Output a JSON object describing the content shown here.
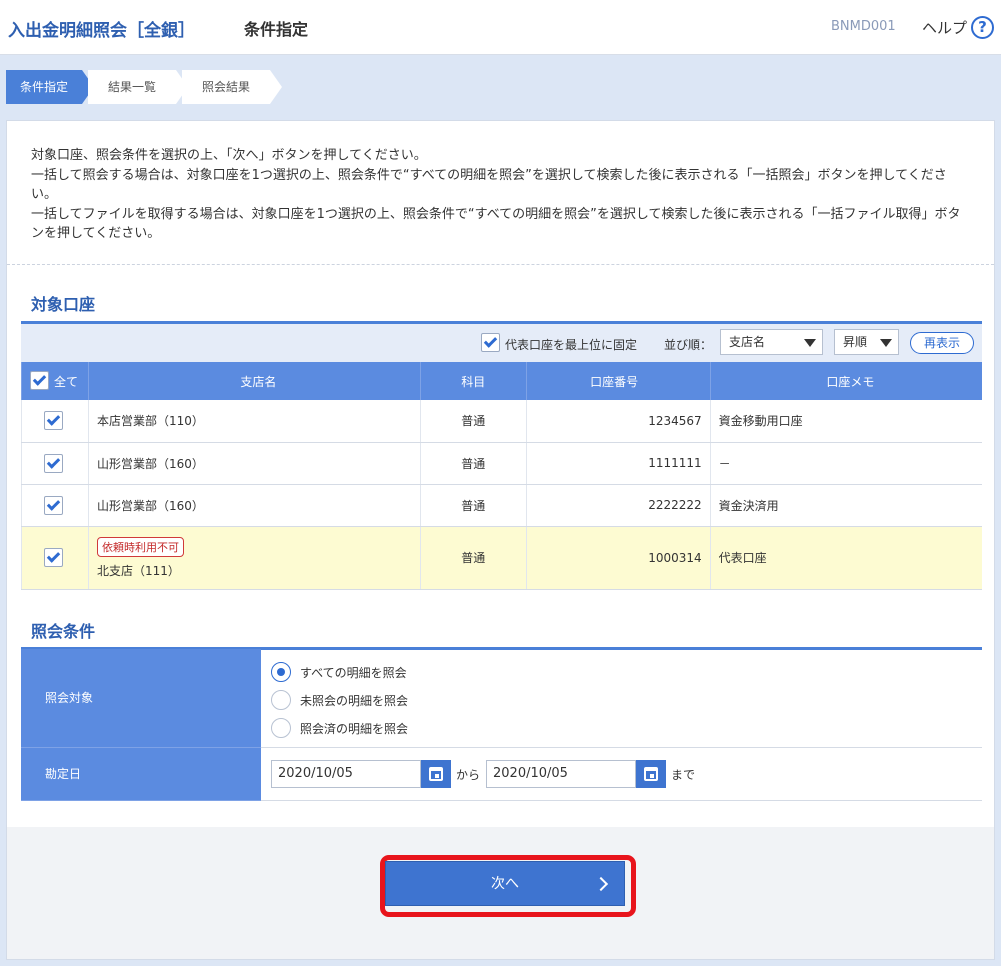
{
  "header": {
    "app_title": "入出金明細照会［全銀］",
    "page_title": "条件指定",
    "screen_id": "BNMD001",
    "help_label": "ヘルプ",
    "help_icon": "?"
  },
  "steps": [
    {
      "label": "条件指定",
      "active": true
    },
    {
      "label": "結果一覧",
      "active": false
    },
    {
      "label": "照会結果",
      "active": false
    }
  ],
  "instructions": [
    "対象口座、照会条件を選択の上、「次へ」ボタンを押してください。",
    "一括して照会する場合は、対象口座を1つ選択の上、照会条件で“すべての明細を照会”を選択して検索した後に表示される「一括照会」ボタンを押してください。",
    "一括してファイルを取得する場合は、対象口座を1つ選択の上、照会条件で“すべての明細を照会”を選択して検索した後に表示される「一括ファイル取得」ボタンを押してください。"
  ],
  "accounts": {
    "title": "対象口座",
    "toolbar": {
      "pin_label": "代表口座を最上位に固定",
      "pin_checked": true,
      "sort_label": "並び順：",
      "sort_field": "支店名",
      "sort_order": "昇順",
      "redisplay": "再表示"
    },
    "columns": {
      "all": "全て",
      "branch": "支店名",
      "type": "科目",
      "number": "口座番号",
      "memo": "口座メモ"
    },
    "rows": [
      {
        "checked": true,
        "branch": "本店営業部（110）",
        "type": "普通",
        "number": "1234567",
        "memo": "資金移動用口座"
      },
      {
        "checked": true,
        "branch": "山形営業部（160）",
        "type": "普通",
        "number": "1111111",
        "memo": "－"
      },
      {
        "checked": true,
        "branch": "山形営業部（160）",
        "type": "普通",
        "number": "2222222",
        "memo": "資金決済用"
      },
      {
        "checked": true,
        "badge": "依頼時利用不可",
        "branch": "北支店（111）",
        "type": "普通",
        "number": "1000314",
        "memo": "代表口座"
      }
    ]
  },
  "conditions": {
    "title": "照会条件",
    "target_label": "照会対象",
    "options": [
      {
        "label": "すべての明細を照会",
        "selected": true
      },
      {
        "label": "未照会の明細を照会",
        "selected": false
      },
      {
        "label": "照会済の明細を照会",
        "selected": false
      }
    ],
    "date_label": "勘定日",
    "date_from": "2020/10/05",
    "date_to": "2020/10/05",
    "from_word": "から",
    "to_word": "まで"
  },
  "next_button": "次へ",
  "colors": {
    "accent": "#3e74d0",
    "header_blue": "#5b8be0",
    "highlight_row": "#fdfbd2",
    "alert_red": "#e8141c"
  }
}
